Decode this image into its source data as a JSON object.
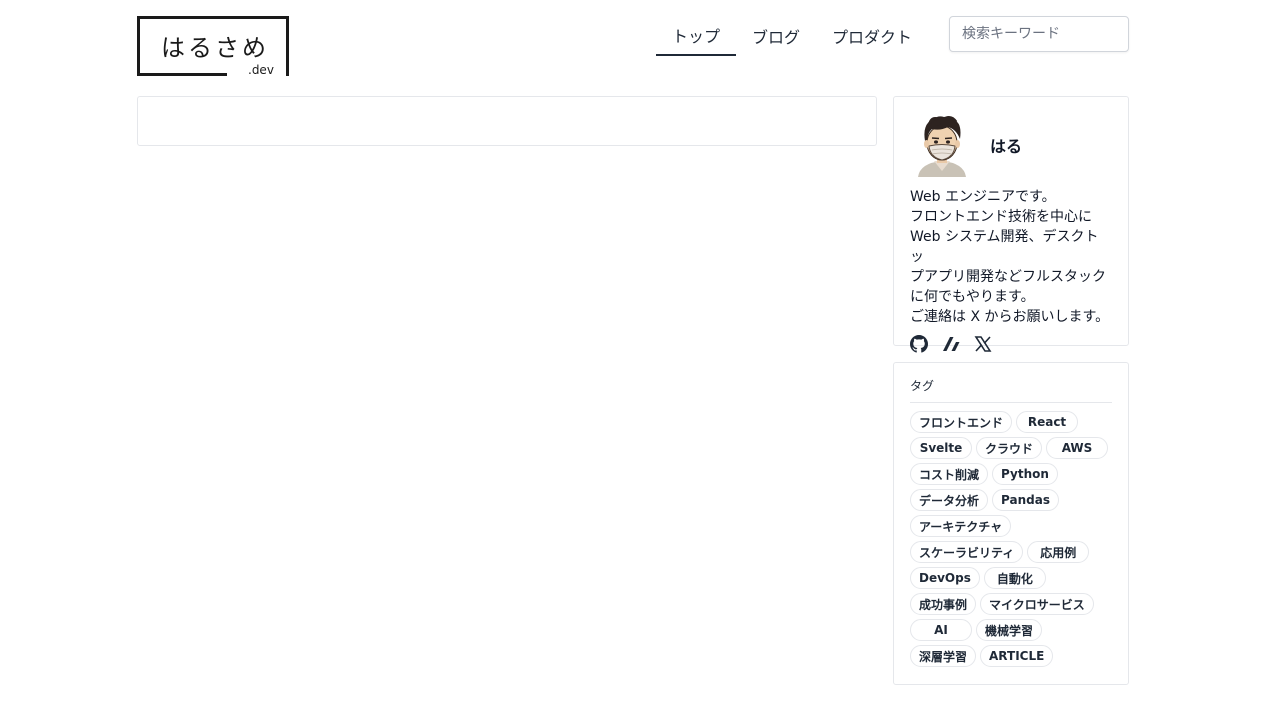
{
  "logo": {
    "text": "はるさめ",
    "suffix": ".dev"
  },
  "nav": [
    {
      "label": "トップ",
      "active": true
    },
    {
      "label": "ブログ",
      "active": false
    },
    {
      "label": "プロダクト",
      "active": false
    }
  ],
  "search": {
    "placeholder": "検索キーワード",
    "value": ""
  },
  "profile": {
    "name": "はる",
    "bio": [
      "Web エンジニアです。",
      "フロントエンド技術を中心に",
      "Web システム開発、デスクトッ",
      "プアプリ開発などフルスタック",
      "に何でもやります。",
      "ご連絡は X からお願いします。"
    ],
    "socials": [
      "github-icon",
      "zenn-icon",
      "x-icon"
    ]
  },
  "tags": {
    "heading": "タグ",
    "items": [
      "フロントエンド",
      "React",
      "Svelte",
      "クラウド",
      "AWS",
      "コスト削減",
      "Python",
      "データ分析",
      "Pandas",
      "アーキテクチャ",
      "スケーラビリティ",
      "応用例",
      "DevOps",
      "自動化",
      "成功事例",
      "マイクロサービス",
      "AI",
      "機械学習",
      "深層学習",
      "ARTICLE"
    ]
  }
}
